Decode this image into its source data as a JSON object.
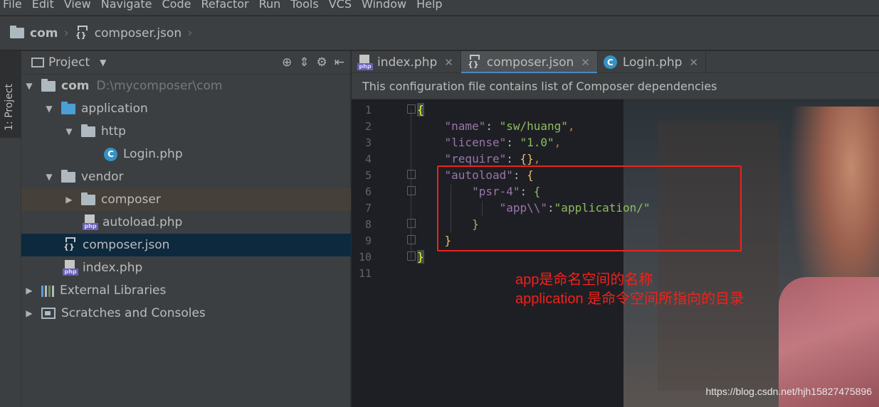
{
  "menu": [
    "File",
    "Edit",
    "View",
    "Navigate",
    "Code",
    "Refactor",
    "Run",
    "Tools",
    "VCS",
    "Window",
    "Help"
  ],
  "breadcrumb": {
    "root": "com",
    "file": "composer.json"
  },
  "tool_window": {
    "label": "1: Project"
  },
  "project_panel": {
    "title": "Project",
    "tree": [
      {
        "label": "com",
        "hint": "D:\\mycomposer\\com"
      },
      {
        "label": "application"
      },
      {
        "label": "http"
      },
      {
        "label": "Login.php"
      },
      {
        "label": "vendor"
      },
      {
        "label": "composer"
      },
      {
        "label": "autoload.php"
      },
      {
        "label": "composer.json"
      },
      {
        "label": "index.php"
      },
      {
        "label": "External Libraries"
      },
      {
        "label": "Scratches and Consoles"
      }
    ]
  },
  "tabs": [
    {
      "label": "index.php"
    },
    {
      "label": "composer.json"
    },
    {
      "label": "Login.php"
    }
  ],
  "banner": "This configuration file contains list of Composer dependencies",
  "editor": {
    "line_numbers": [
      "1",
      "2",
      "3",
      "4",
      "5",
      "6",
      "7",
      "8",
      "9",
      "10",
      "11"
    ],
    "code": {
      "k_name": "\"name\"",
      "v_name": "\"sw/huang\"",
      "k_license": "\"license\"",
      "v_license": "\"1.0\"",
      "k_require": "\"require\"",
      "k_autoload": "\"autoload\"",
      "k_psr4": "\"psr-4\"",
      "k_app": "\"app\\\\\"",
      "v_app": "\"application/\""
    }
  },
  "annotation": {
    "line1": "app是命名空间的名称",
    "line2": "application 是命令空间所指向的目录"
  },
  "watermark": "https://blog.csdn.net/hjh15827475896",
  "colors": {
    "annotation_red": "#e8251e",
    "selection": "#0d293e",
    "tab_underline": "#4a88c7"
  }
}
